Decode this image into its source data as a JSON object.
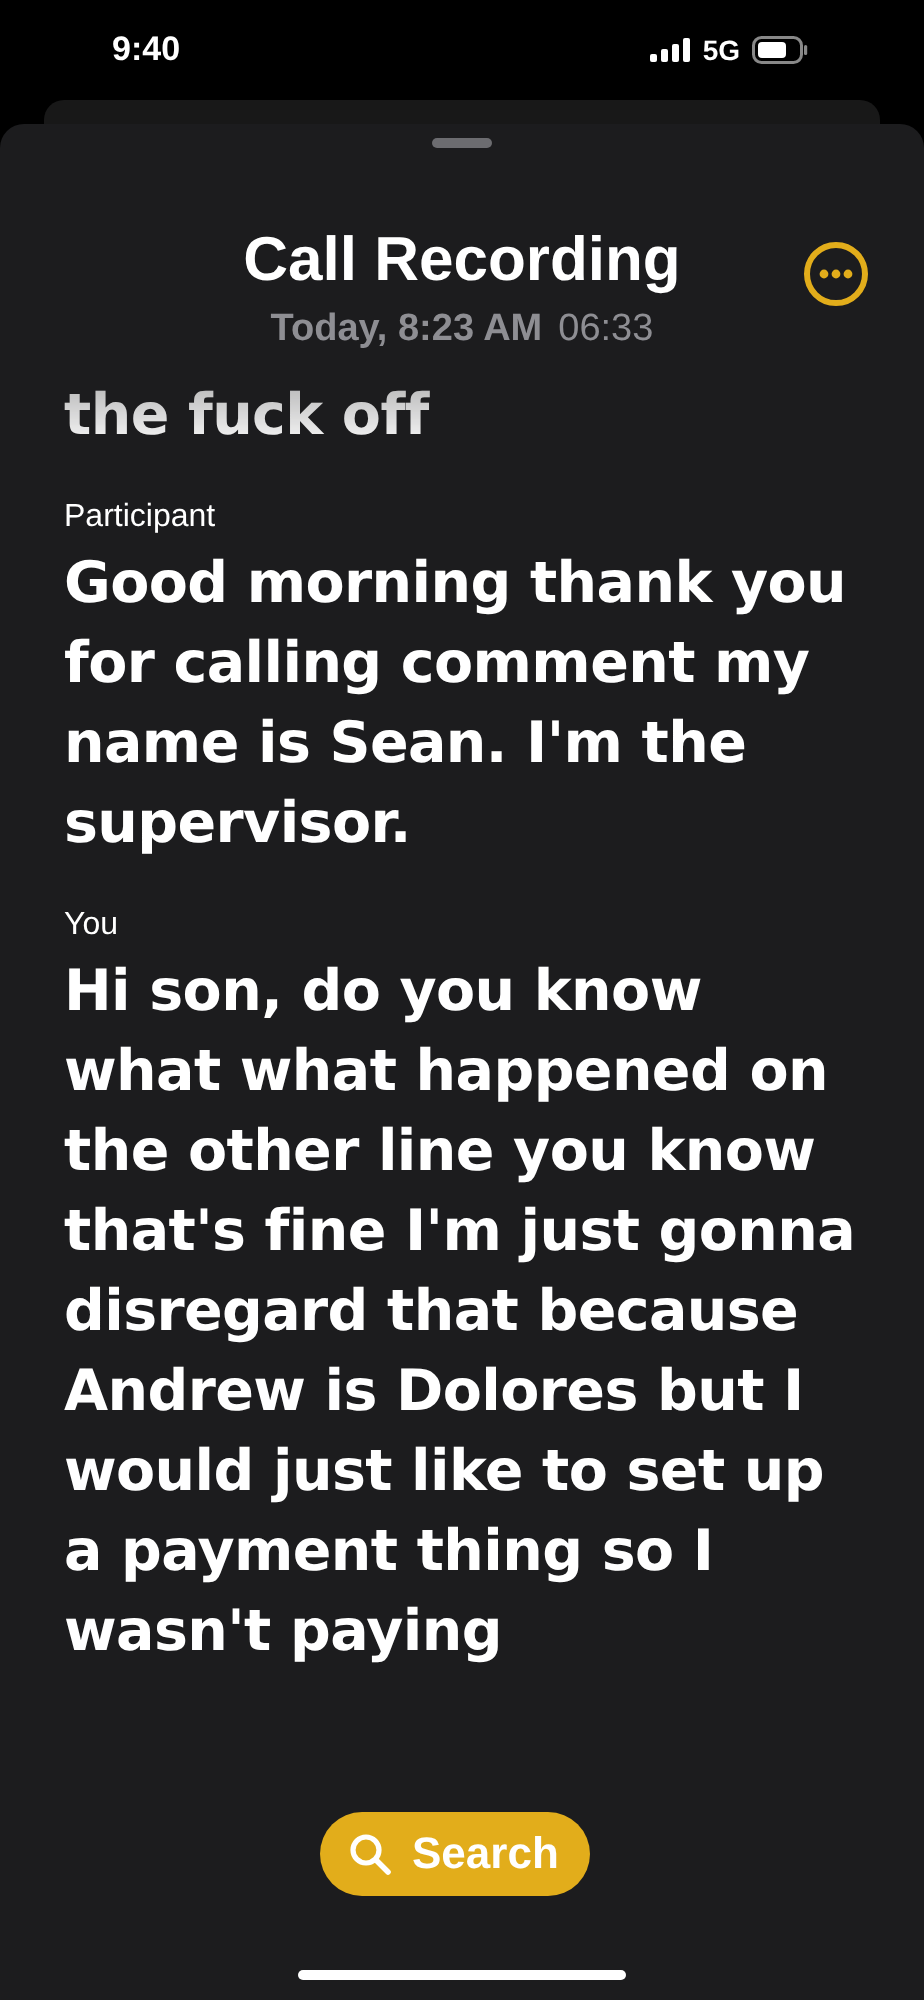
{
  "status_bar": {
    "time": "9:40",
    "network": "5G"
  },
  "header": {
    "title": "Call Recording",
    "date": "Today, 8:23 AM",
    "duration": "06:33"
  },
  "transcript": [
    {
      "text": "the fuck off"
    },
    {
      "speaker": "Participant",
      "text": "Good morning thank you for calling comment my name is Sean. I'm the supervisor."
    },
    {
      "speaker": "You",
      "text": "Hi son, do you know what what happened on the other line you know that's fine I'm just gonna disregard that because Andrew is Dolores but I would just like to set up a payment thing so I wasn't paying"
    }
  ],
  "search_button": {
    "label": "Search"
  }
}
